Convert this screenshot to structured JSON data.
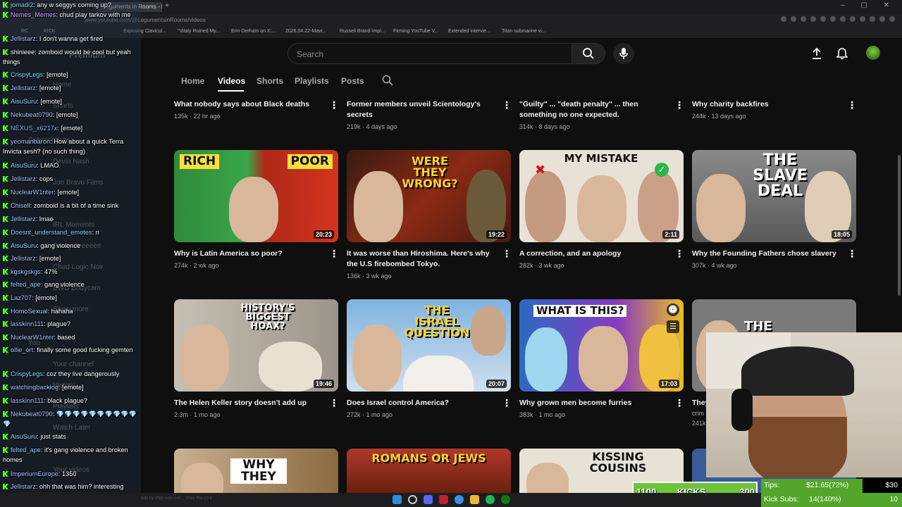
{
  "browser": {
    "tabs": [
      "any w seggys coming up?",
      "Leguments in Rooms - Ken"
    ],
    "url": "www.youtube.com/@LegumentsinRooms/videos",
    "bookmarks": [
      "RC",
      "KICK",
      "Exposing Clavicul...",
      "\"Vitaly Ruined My...",
      "Erin Derham on X:...",
      "2026.04.22-Mavr...",
      "Russell Brand Impl...",
      "Firming YouTube V...",
      "Extended intervie...",
      "Titan submarine vi..."
    ]
  },
  "youtube": {
    "search_placeholder": "Search",
    "channel_tabs": [
      "Home",
      "Videos",
      "Shorts",
      "Playlists",
      "Posts"
    ],
    "active_tab": "Videos",
    "sidebar_items": [
      "Premium",
      "Home",
      "Shorts",
      "Subscriptions",
      "Devin Nash",
      "Jon Bravo Films",
      "IRL Moments",
      "Sassy Jeeeeee",
      "Chud Logic Noir",
      "EWU Bodycam",
      "Show more",
      "You",
      "Your channel",
      "History",
      "Playlists",
      "Watch Later",
      "Your videos"
    ],
    "top_row": [
      {
        "title": "What nobody says about Black deaths",
        "meta": "135k · 22 hr ago"
      },
      {
        "title": "Former members unveil Scientology's secrets",
        "meta": "219k · 4 days ago"
      },
      {
        "title": "\"Guilty\" ... \"death penalty\" ... then something no one expected.",
        "meta": "314k · 8 days ago"
      },
      {
        "title": "Why charity backfires",
        "meta": "244k · 13 days ago"
      }
    ],
    "row2": [
      {
        "thumb_text_left": "RICH",
        "thumb_text_right": "POOR",
        "duration": "20:23",
        "title": "Why is Latin America so poor?",
        "meta": "274k · 2 wk ago"
      },
      {
        "thumb_text": "WERE THEY WRONG?",
        "duration": "19:22",
        "title": "It was worse than Hiroshima. Here's why the U.S firebombed Tokyo.",
        "meta": "136k · 3 wk ago"
      },
      {
        "thumb_text": "MY MISTAKE",
        "duration": "2:11",
        "title": "A correction, and an apology",
        "meta": "282k · 3 wk ago"
      },
      {
        "thumb_text": "THE SLAVE DEAL",
        "duration": "18:05",
        "title": "Why the Founding Fathers chose slavery",
        "meta": "307k · 4 wk ago"
      }
    ],
    "row3": [
      {
        "thumb_text": "HISTORY'S BIGGEST HOAX?",
        "duration": "19:46",
        "title": "The Helen Keller story doesn't add up",
        "meta": "2.3m · 1 mo ago"
      },
      {
        "thumb_text": "THE ISRAEL QUESTION",
        "duration": "20:07",
        "title": "Does Israel control America?",
        "meta": "272k · 1 mo ago"
      },
      {
        "thumb_text": "WHAT IS THIS?",
        "duration": "17:03",
        "title": "Why grown men become furries",
        "meta": "383k · 1 mo ago"
      },
      {
        "thumb_text": "THE",
        "duration": "",
        "title": "They",
        "title2": "crim",
        "meta": "241k"
      }
    ],
    "row4": [
      {
        "thumb_text": "WHY THEY"
      },
      {
        "thumb_text": "ROMANS OR JEWS"
      },
      {
        "thumb_text": "KISSING COUSINS"
      },
      {
        "thumb_text": ""
      }
    ]
  },
  "chat": [
    {
      "user": "jomadi2",
      "color": "#8fd3ff",
      "msg": "any w seggys coming up?"
    },
    {
      "user": "Nemes_Memes",
      "color": "#c7a4ff",
      "msg": "chud play tarkov with me"
    },
    {
      "user": "Jellistarz",
      "color": "#a3c3ff",
      "msg": "I don't wanna get fired"
    },
    {
      "user": "shinieee",
      "color": "#ffffff",
      "msg": "zomboid would be cool but yeah things"
    },
    {
      "user": "CrispyLegs",
      "color": "#7fe0ff",
      "msg": "[emote]"
    },
    {
      "user": "Jellistarz",
      "color": "#a3c3ff",
      "msg": "[emote]"
    },
    {
      "user": "AisuSuru",
      "color": "#9ad8ff",
      "msg": "[emote]"
    },
    {
      "user": "Nekubeat0790",
      "color": "#a9c6ff",
      "msg": "[emote]"
    },
    {
      "user": "NEXUS_x6217x",
      "color": "#8ab8ff",
      "msg": "[emote]"
    },
    {
      "user": "yeomanbaron",
      "color": "#a3c3ff",
      "msg": "How about a quick Terra Invicta sesh? (no such thing)"
    },
    {
      "user": "AisuSuru",
      "color": "#9ad8ff",
      "msg": "LMAO"
    },
    {
      "user": "Jellistarz",
      "color": "#a3c3ff",
      "msg": "cops"
    },
    {
      "user": "NuclearW1nter",
      "color": "#a3c3ff",
      "msg": "[emote]"
    },
    {
      "user": "Chisell",
      "color": "#9ad8ff",
      "msg": "zomboid is a bit of a time sink"
    },
    {
      "user": "Jellistarz",
      "color": "#a3c3ff",
      "msg": "lmao"
    },
    {
      "user": "Doesnt_understand_emotes",
      "color": "#8fd3ff",
      "msg": "n"
    },
    {
      "user": "AisuSuru",
      "color": "#9ad8ff",
      "msg": "gang violence"
    },
    {
      "user": "Jellistarz",
      "color": "#a3c3ff",
      "msg": "[emote]"
    },
    {
      "user": "kgskgskgs",
      "color": "#a3c3ff",
      "msg": "47%"
    },
    {
      "user": "felted_ape",
      "color": "#8fd3ff",
      "msg": "gang violence"
    },
    {
      "user": "Laz707",
      "color": "#a3c3ff",
      "msg": "[emote]"
    },
    {
      "user": "HomoSexual",
      "color": "#9ad8ff",
      "msg": "hahaha"
    },
    {
      "user": "lasskinn111",
      "color": "#a3c3ff",
      "msg": "plague?"
    },
    {
      "user": "NuclearW1nter",
      "color": "#a3c3ff",
      "msg": "based"
    },
    {
      "user": "ollie_ort",
      "color": "#a3c3ff",
      "msg": "finally some good fucking gemten"
    },
    {
      "user": "CrispyLegs",
      "color": "#7fe0ff",
      "msg": "coz they live dangerously"
    },
    {
      "user": "watchingbacklog",
      "color": "#a3c3ff",
      "msg": "[emote]"
    },
    {
      "user": "lasskinn111",
      "color": "#a3c3ff",
      "msg": "black plague?"
    },
    {
      "user": "Nekubeat0790",
      "color": "#a9c6ff",
      "msg": "💎💎💎💎💎💎💎💎💎💎💎"
    },
    {
      "user": "AisuSuru",
      "color": "#9ad8ff",
      "msg": "just stats"
    },
    {
      "user": "felted_ape",
      "color": "#8fd3ff",
      "msg": "it's gang violence and broken homes"
    },
    {
      "user": "ImperiumEurope",
      "color": "#a3c3ff",
      "msg": "1350"
    },
    {
      "user": "Jellistarz",
      "color": "#a3c3ff",
      "msg": "ohh that was him? interesting"
    }
  ],
  "overlay": {
    "goal_left": "1100",
    "goal_label": "KICKS",
    "goal_right": "300",
    "tips_label": "Tips:",
    "tips_value": "$21.65(72%)",
    "tips_goal": "$30",
    "subs_label": "Kick Subs:",
    "subs_value": "14(140%)",
    "subs_goal": "10",
    "ad_text": "Ads by 2Nd-xxxx-cvrr... 10eo Rtu-cJ-k"
  },
  "colors": {
    "kick_green": "#53fc18",
    "yt_bg": "#0f0f0f",
    "overlay_green": "#6ec33a"
  }
}
